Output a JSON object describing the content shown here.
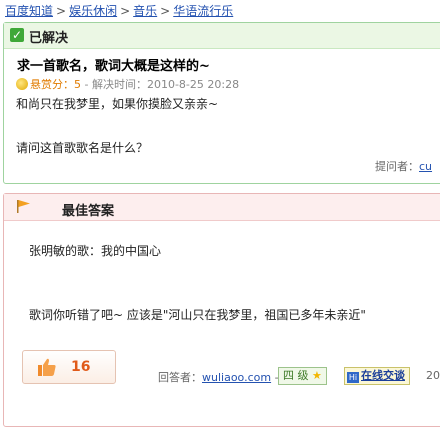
{
  "breadcrumb": [
    "百度知道",
    "娱乐休闲",
    "音乐",
    "华语流行乐"
  ],
  "breadcrumb_sep": ">",
  "question": {
    "status": "已解决",
    "title": "求一首歌名，歌词大概是这样的~",
    "reward_label": "悬赏分：5",
    "solved_time": " - 解决时间：2010-8-25 20:28",
    "body_line1": "和尚只在我梦里，如果你摸脸又亲亲~",
    "body_line2": "请问这首歌歌名是什么？",
    "asker_label": "提问者：",
    "asker_name": "cu"
  },
  "best_answer": {
    "title": "最佳答案",
    "line1": "张明敏的歌：我的中国心",
    "line2": "歌词你听错了吧~  应该是\"河山只在我梦里，祖国已多年未亲近\"",
    "likes": "16",
    "answerer_label": "回答者：",
    "answerer_name": "wuliaoo.com",
    "answerer_sep": " -",
    "level": "四 级",
    "chat_label": "在线交谈",
    "date_tail": "20"
  }
}
